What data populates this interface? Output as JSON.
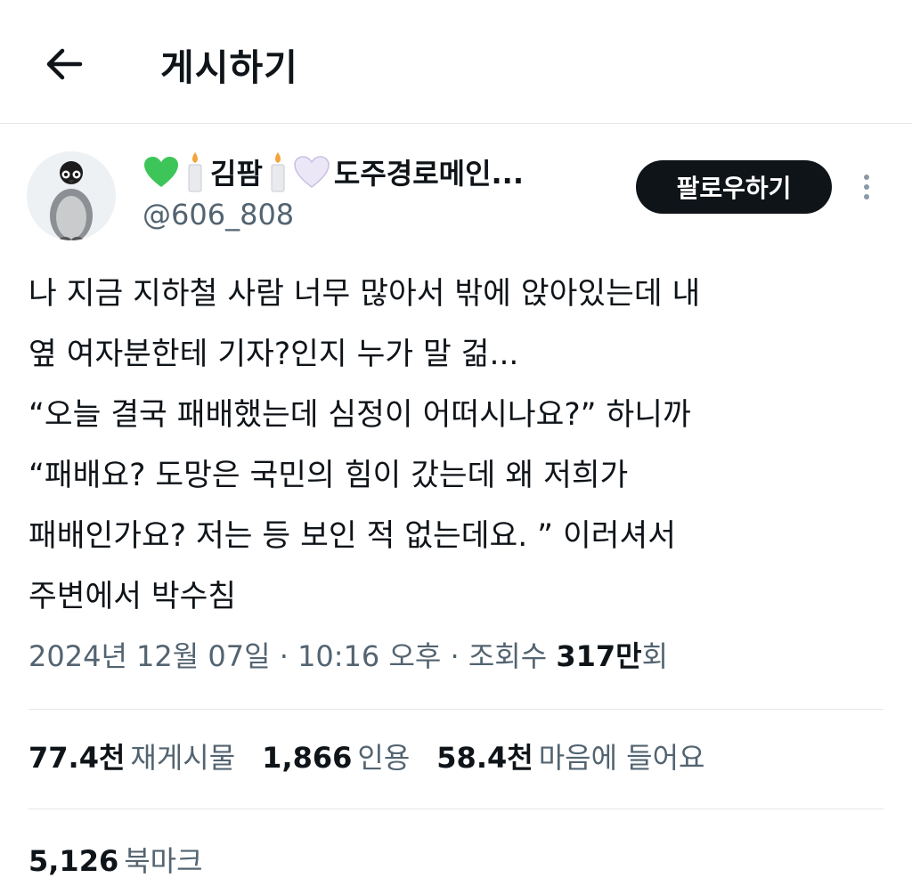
{
  "header": {
    "title": "게시하기",
    "back_icon": "arrow-left-icon"
  },
  "author": {
    "emoji_heart_green": "💚",
    "emoji_candle_1": "🕯",
    "name": "김팜",
    "emoji_candle_2": "🕯",
    "emoji_heart_white": "🤍",
    "name_suffix": "도주경로메인...",
    "handle": "@606_808",
    "avatar_icon": "penguin-avatar"
  },
  "follow_button": {
    "label": "팔로우하기"
  },
  "more_icon": "more-vertical-icon",
  "tweet": {
    "lines": [
      "나 지금 지하철 사람 너무 많아서 밖에 앉아있는데 내",
      "옆 여자분한테 기자?인지 누가 말 걺...",
      "“오늘 결국 패배했는데 심정이 어떠시나요?” 하니까",
      "“패배요? 도망은 국민의 힘이 갔는데 왜 저희가",
      "패배인가요? 저는 등 보인 적 없는데요. ” 이러셔서",
      "주변에서 박수침"
    ]
  },
  "meta": {
    "date": "2024년 12월 07일",
    "separator1": " · ",
    "time": "10:16 오후",
    "separator2": " · ",
    "views_label": "조회수 ",
    "views_value": "317만",
    "views_suffix": "회"
  },
  "stats": {
    "reposts": {
      "value": "77.4천",
      "label": "재게시물"
    },
    "quotes": {
      "value": "1,866",
      "label": "인용"
    },
    "likes": {
      "value": "58.4천",
      "label": "마음에 들어요"
    },
    "bookmarks": {
      "value": "5,126",
      "label": "북마크"
    }
  }
}
